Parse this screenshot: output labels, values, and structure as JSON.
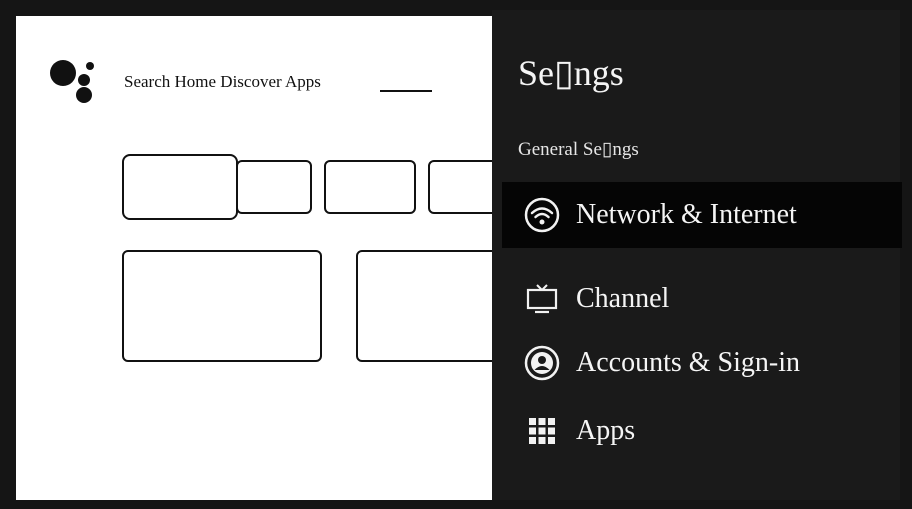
{
  "home": {
    "nav_text": "Search Home Discover Apps"
  },
  "settings": {
    "title": "Se▯ngs",
    "section_title": "General Se▯ngs",
    "items": [
      {
        "label": "Network & Internet",
        "icon": "wifi-icon",
        "selected": true
      },
      {
        "label": "Channel",
        "icon": "tv-icon",
        "selected": false
      },
      {
        "label": "Accounts & Sign-in",
        "icon": "account-icon",
        "selected": false
      },
      {
        "label": "Apps",
        "icon": "apps-grid-icon",
        "selected": false
      }
    ]
  },
  "colors": {
    "panel_bg": "#1a1a1a",
    "selected_bg": "#050505",
    "frame": "#151515"
  }
}
